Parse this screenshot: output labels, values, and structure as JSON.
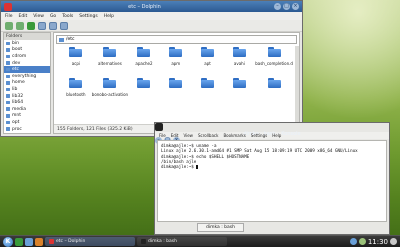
{
  "dolphin": {
    "title": "etc – Dolphin",
    "menu": [
      "File",
      "Edit",
      "View",
      "Go",
      "Tools",
      "Settings",
      "Help"
    ],
    "places_header": "Folders",
    "location": "/etc",
    "places": [
      {
        "label": "bin"
      },
      {
        "label": "boot"
      },
      {
        "label": "cdrom"
      },
      {
        "label": "dev"
      },
      {
        "label": "etc",
        "selected": true
      },
      {
        "label": "everything"
      },
      {
        "label": "home"
      },
      {
        "label": "lib"
      },
      {
        "label": "lib32"
      },
      {
        "label": "lib64"
      },
      {
        "label": "media"
      },
      {
        "label": "mnt"
      },
      {
        "label": "opt"
      },
      {
        "label": "proc"
      }
    ],
    "files": [
      "acpi",
      "alternatives",
      "apache2",
      "apm",
      "apt",
      "avahi",
      "bash_completion.d",
      "bluetooth",
      "bonobo-activation",
      "",
      "",
      "",
      "",
      ""
    ],
    "status": "155 Folders, 121 Files (325.2 KiB)",
    "zoom_level": 0.5,
    "free_space_label": "339.6 MB free",
    "free_space_used_fraction": 0.7
  },
  "konsole": {
    "title": "dimka : bash – Konsole",
    "menu": [
      "File",
      "Edit",
      "View",
      "Scrollback",
      "Bookmarks",
      "Settings",
      "Help"
    ],
    "lines": [
      "dimka@ajle:~$ uname -a",
      "Linux ajle 2.6.30.1-amd64 #1 SMP Sat Aug 15 18:09:19 UTC 2009 x86_64 GNU/Linux",
      "dimka@ajle:~$ echo $SHELL $HOSTNAME",
      "/bin/bash ajle",
      "dimka@ajle:~$ "
    ],
    "tabs": [
      "dimka : bash"
    ]
  },
  "panel": {
    "tasks": [
      "etc – Dolphin",
      "dimka : bash"
    ],
    "clock": "11:30"
  },
  "colors": {
    "titlebar": "#2c5a92",
    "selection": "#4a80c8",
    "folder": "#2d6cc2"
  }
}
